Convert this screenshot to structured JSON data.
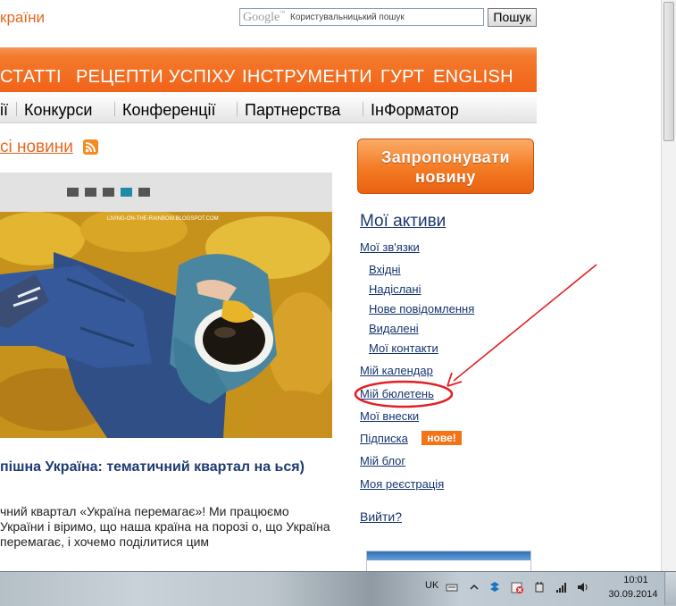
{
  "header": {
    "site_title": "країни",
    "search": {
      "logo": "Google",
      "placeholder": "Користувальницький пошук",
      "button": "Пошук"
    }
  },
  "main_menu": [
    "СТАТТІ",
    "РЕЦЕПТИ УСПІХУ",
    "ІНСТРУМЕНТИ",
    "ГУРТ",
    "ENGLISH"
  ],
  "sub_menu": [
    "ії",
    "Конкурси",
    "Конференції",
    "Партнерства",
    "ІнФорматор"
  ],
  "news": {
    "title": "сі новини",
    "slider_count": 5,
    "slider_active": 4,
    "image_credit": "LIVING-ON-THE-RAINBOW.BLOGSPOT.COM",
    "article_title": "пішна Україна: тематичний квартал на ься)",
    "article_text": "чний квартал «Україна перемагає»! Ми працюємо України і віримо, що наша країна на порозі о, що Україна перемагає, і хочемо поділитися цим"
  },
  "sidebar": {
    "propose_button": "Запропонувати новину",
    "assets_title": "Мої активи",
    "links": {
      "connections": "Мої зв'язки",
      "inbox": "Вхідні",
      "sent": "Надіслані",
      "new_message": "Нове повідомлення",
      "deleted": "Видалені",
      "contacts": "Мої контакти",
      "calendar": "Мій календар",
      "bulletin": "Мій бюлетень",
      "contributions": "Мої внески",
      "subscription": "Підписка",
      "blog": "Мій блог",
      "registration": "Моя реєстрація",
      "logout": "Вийти?"
    },
    "new_badge": "нове!"
  },
  "annotation": {
    "color": "#e41e24",
    "target": "Мій бюлетень"
  },
  "taskbar": {
    "language": "UK",
    "time": "10:01",
    "date": "30.09.2014"
  },
  "colors": {
    "accent": "#f26319",
    "link": "#14346f",
    "annotation_red": "#e41e24"
  }
}
